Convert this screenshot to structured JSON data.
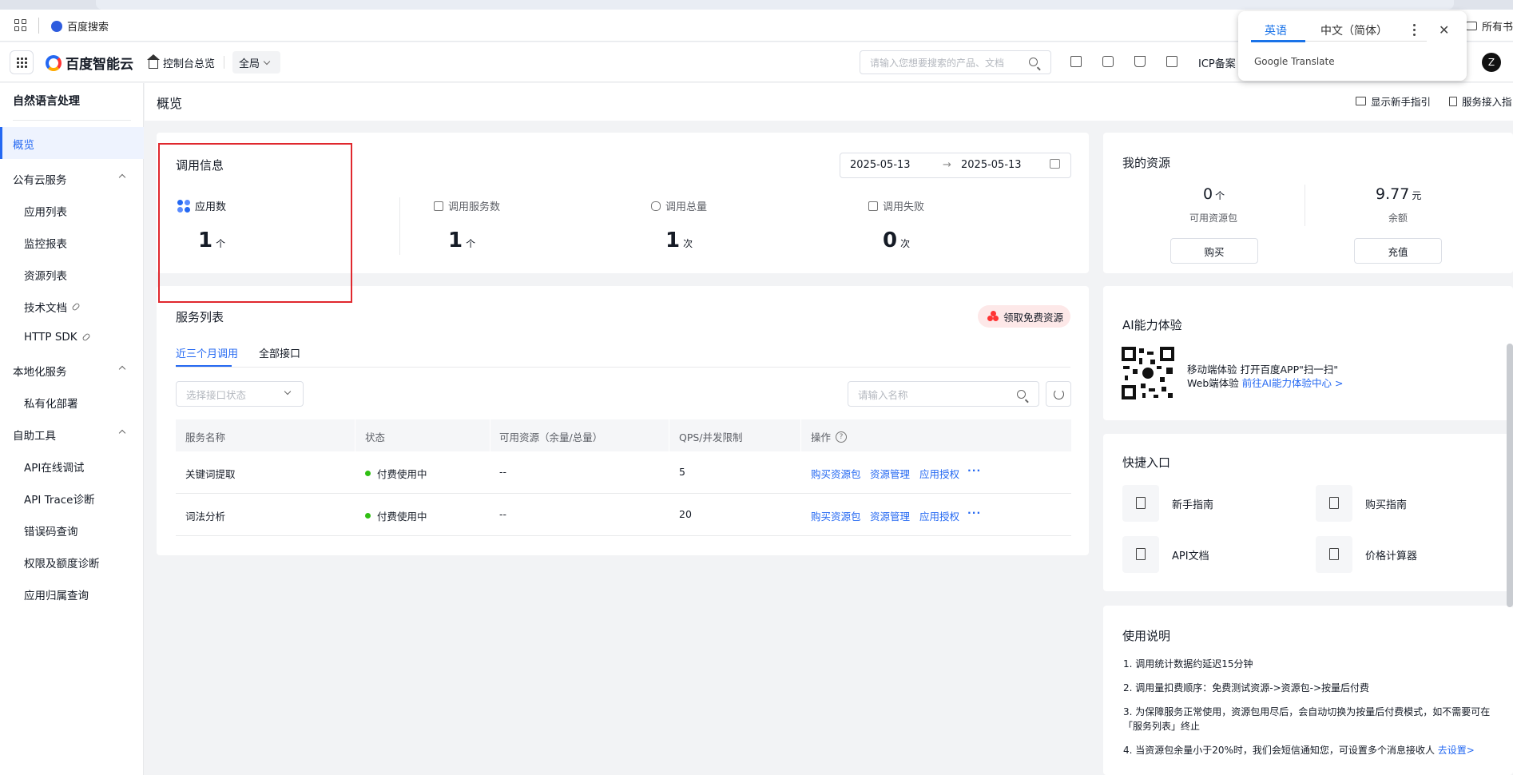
{
  "browser": {
    "bookmark_label": "百度搜索",
    "all_bookmarks": "所有书"
  },
  "header": {
    "brand": "百度智能云",
    "console_home": "控制台总览",
    "region": "全局",
    "search_placeholder": "请输入您想要搜索的产品、文档",
    "icp": "ICP备案",
    "avatar_letter": "Z",
    "icons": [
      "qrcode-icon",
      "message-icon",
      "cart-icon",
      "billing-icon"
    ]
  },
  "translate_popup": {
    "tab_en": "英语",
    "tab_zh": "中文（简体）",
    "close": "✕",
    "brand": "Google Translate"
  },
  "sidebar": {
    "title": "自然语言处理",
    "overview": "概览",
    "groups": [
      {
        "label": "公有云服务",
        "items": [
          "应用列表",
          "监控报表",
          "资源列表",
          "技术文档",
          "HTTP SDK"
        ]
      },
      {
        "label": "本地化服务",
        "items": [
          "私有化部署"
        ]
      },
      {
        "label": "自助工具",
        "items": [
          "API在线调试",
          "API Trace诊断",
          "错误码查询",
          "权限及额度诊断",
          "应用归属查询"
        ]
      }
    ]
  },
  "page": {
    "title": "概览",
    "show_guide": "显示新手指引",
    "service_guide": "服务接入指"
  },
  "call_info": {
    "title": "调用信息",
    "date_start": "2025-05-13",
    "date_arrow": "→",
    "date_end": "2025-05-13",
    "stats": [
      {
        "label": "应用数",
        "value": "1",
        "unit": "个"
      },
      {
        "label": "调用服务数",
        "value": "1",
        "unit": "个"
      },
      {
        "label": "调用总量",
        "value": "1",
        "unit": "次"
      },
      {
        "label": "调用失败",
        "value": "0",
        "unit": "次"
      }
    ]
  },
  "service_list": {
    "title": "服务列表",
    "free_badge": "领取免费资源",
    "tabs": [
      "近三个月调用",
      "全部接口"
    ],
    "status_placeholder": "选择接口状态",
    "name_placeholder": "请输入名称",
    "columns": [
      "服务名称",
      "状态",
      "可用资源（余量/总量）",
      "QPS/并发限制",
      "操作"
    ],
    "rows": [
      {
        "name": "关键词提取",
        "status": "付费使用中",
        "resource": "--",
        "qps": "5"
      },
      {
        "name": "词法分析",
        "status": "付费使用中",
        "resource": "--",
        "qps": "20"
      }
    ],
    "ops": [
      "购买资源包",
      "资源管理",
      "应用授权",
      "···"
    ],
    "status_color": "#30bf13"
  },
  "resources": {
    "title": "我的资源",
    "packages_value": "0",
    "packages_unit": "个",
    "packages_label": "可用资源包",
    "balance_value": "9.77",
    "balance_unit": "元",
    "balance_label": "余额",
    "buy": "购买",
    "recharge": "充值"
  },
  "ai_experience": {
    "title": "AI能力体验",
    "mobile": "移动端体验 打开百度APP\"扫一扫\"",
    "web_prefix": "Web端体验 ",
    "web_link": "前往AI能力体验中心 >"
  },
  "shortcuts": {
    "title": "快捷入口",
    "items": [
      "新手指南",
      "购买指南",
      "API文档",
      "价格计算器"
    ]
  },
  "usage_notes": {
    "title": "使用说明",
    "lines": [
      "1. 调用统计数据约延迟15分钟",
      "2. 调用量扣费顺序：免费测试资源->资源包->按量后付费",
      "3. 为保障服务正常使用，资源包用尽后，会自动切换为按量后付费模式，如不需要可在「服务列表」终止",
      "4. 当资源包余量小于20%时，我们会短信通知您，可设置多个消息接收人 "
    ],
    "set_link": "去设置>"
  },
  "colors": {
    "accent": "#2468f2",
    "highlight_border": "#e0282e"
  }
}
